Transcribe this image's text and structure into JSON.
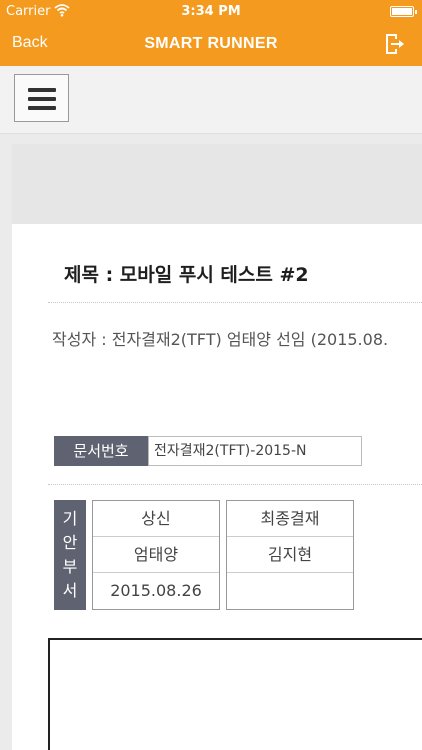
{
  "status_bar": {
    "carrier": "Carrier",
    "time": "3:34 PM"
  },
  "nav": {
    "back_label": "Back",
    "title": "SMART RUNNER",
    "exit_icon": "exit-icon"
  },
  "document": {
    "title": "제목 : 모바일 푸시 테스트 #2",
    "author": "작성자 : 전자결재2(TFT) 엄태양 선임 (2015.08.",
    "doc_number_label": "문서번호",
    "doc_number_value": "전자결재2(TFT)-2015-N",
    "draft_label_chars": [
      "기",
      "안",
      "부",
      "서"
    ],
    "approval_columns": [
      {
        "role": "상신",
        "name": "엄태양",
        "date": "2015.08.26"
      },
      {
        "role": "최종결재",
        "name": "김지현",
        "date": ""
      }
    ]
  },
  "colors": {
    "accent": "#f39a1f",
    "label_bg": "#5f6270"
  }
}
